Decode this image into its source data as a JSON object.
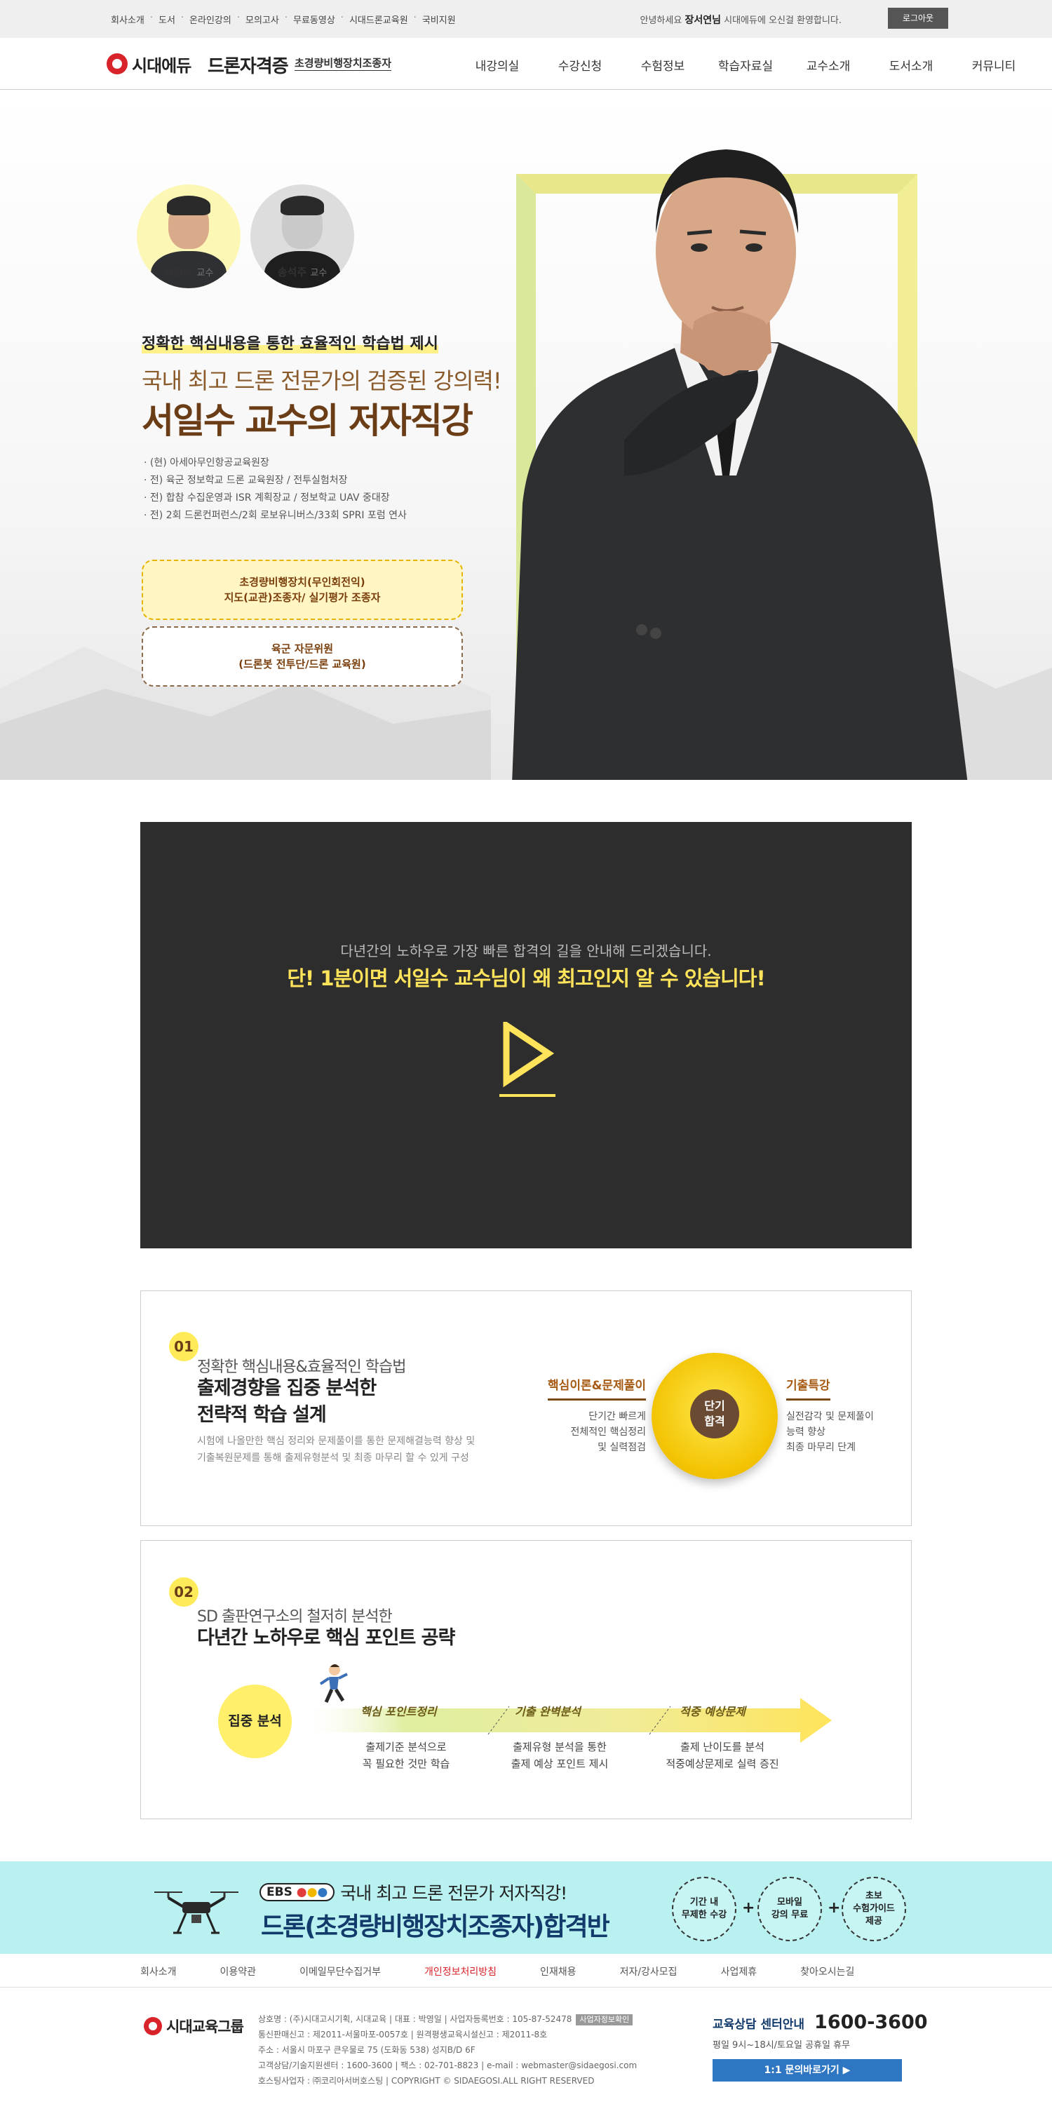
{
  "util": {
    "links": [
      "회사소개",
      "도서",
      "온라인강의",
      "모의고사",
      "무료동영상",
      "시대드론교육원",
      "국비지원"
    ],
    "greeting_pre": "안녕하세요",
    "user": "장서연님",
    "greeting_post": "시대에듀에 오신걸 환영합니다.",
    "logout": "로그아웃"
  },
  "header": {
    "logo": "시대에듀",
    "title": "드론자격증",
    "subtitle": "초경량비행장치조종자",
    "menu": [
      "내강의실",
      "수강신청",
      "수험정보",
      "학습자료실",
      "교수소개",
      "도서소개",
      "커뮤니티"
    ]
  },
  "hero": {
    "professors": [
      {
        "name": "서일수",
        "title": "교수"
      },
      {
        "name": "송석주",
        "title": "교수"
      }
    ],
    "tagline": "정확한 핵심내용을 통한 효율적인 학습법 제시",
    "subheading": "국내 최고 드론 전문가의 검증된 강의력!",
    "heading": "서일수 교수의 저자직강",
    "credentials": [
      "· (현) 아세아무인항공교육원장",
      "· 전) 육군 정보학교 드론 교육원장 / 전투실험처장",
      "· 전) 합참 수집운영과 ISR 계획장교 / 정보학교 UAV 중대장",
      "· 전) 2회 드론컨퍼런스/2회 로보유니버스/33회 SPRI 포럼 연사"
    ],
    "badge1": [
      "초경량비행장치(무인회전익)",
      "지도(교관)조종자/ 실기평가 조종자"
    ],
    "badge2": [
      "육군 자문위원",
      "(드론봇 전투단/드론 교육원)"
    ]
  },
  "video": {
    "line1": "다년간의 노하우로 가장 빠른 합격의 길을 안내해 드리겠습니다.",
    "line2": "단! 1분이면 서일수 교수님이 왜 최고인지 알 수 있습니다!"
  },
  "box1": {
    "num": "01",
    "sub": "정확한 핵심내용&효율적인 학습법",
    "title1": "출제경향을 집중 분석한",
    "title2": "전략적 학습 설계",
    "desc1": "시험에 나올만한 핵심 정리와 문제풀이를 통한 문제해결능력 향상 및",
    "desc2": "기출복원문제를 통해 출제유형분석 및 최종 마무리 할 수 있게 구성",
    "left_title": "핵심이론&문제풀이",
    "left_desc": [
      "단기간 빠르게",
      "전체적인 핵심정리",
      "및 실력점검"
    ],
    "center": [
      "단기",
      "합격"
    ],
    "right_title": "기출특강",
    "right_desc": [
      "실전감각 및 문제풀이",
      "능력 향상",
      "최종 마무리 단계"
    ]
  },
  "box2": {
    "num": "02",
    "sub": "SD 출판연구소의 철저히 분석한",
    "title": "다년간 노하우로 핵심 포인트 공략",
    "focus": "집중 분석",
    "steps": [
      {
        "label": "핵심 포인트정리",
        "desc": [
          "출제기준 분석으로",
          "꼭 필요한 것만 학습"
        ]
      },
      {
        "label": "기출 완벽분석",
        "desc": [
          "출제유형 분석을 통한",
          "출제 예상 포인트 제시"
        ]
      },
      {
        "label": "적중 예상문제",
        "desc": [
          "출제 난이도를 분석",
          "적중예상문제로 실력 증진"
        ]
      }
    ]
  },
  "banner": {
    "ebs": "EBS",
    "line1": "국내 최고 드론 전문가 저자직강!",
    "line2": "드론(초경량비행장치조종자)합격반",
    "circles": [
      [
        "기간 내",
        "무제한 수강"
      ],
      [
        "모바일",
        "강의 무료"
      ],
      [
        "초보",
        "수험가이드",
        "제공"
      ]
    ]
  },
  "footer": {
    "links": [
      "회사소개",
      "이용약관",
      "이메일무단수집거부",
      "개인정보처리방침",
      "인재채용",
      "저자/강사모집",
      "사업제휴",
      "찾아오시는길"
    ],
    "logo": "시대교육그룹",
    "info": [
      "상호명 : (주)시대고시기획, 시대교육 | 대표 : 박영일 | 사업자등록번호 : 105-87-52478",
      "통신판매신고 : 제2011-서울마포-0057호 | 원격평생교육시설신고 : 제2011-8호",
      "주소 : 서울시 마포구 큰우물로 75 (도화동 538) 성지B/D 6F",
      "고객상담/기술지원센터 : 1600-3600 | 팩스 : 02-701-8823 | e-mail : webmaster@sidaegosi.com",
      "호스팅사업자 : ㈜코리아서버호스팅 | COPYRIGHT © SIDAEGOSI.ALL RIGHT RESERVED"
    ],
    "biz_btn": "사업자정보확인",
    "cs_title": "교육상담 센터안내",
    "cs_phone": "1600-3600",
    "cs_hours": "평일 9시~18시/토요일 공휴일 휴무",
    "cs_button": "1:1 문의바로가기 ▶"
  }
}
